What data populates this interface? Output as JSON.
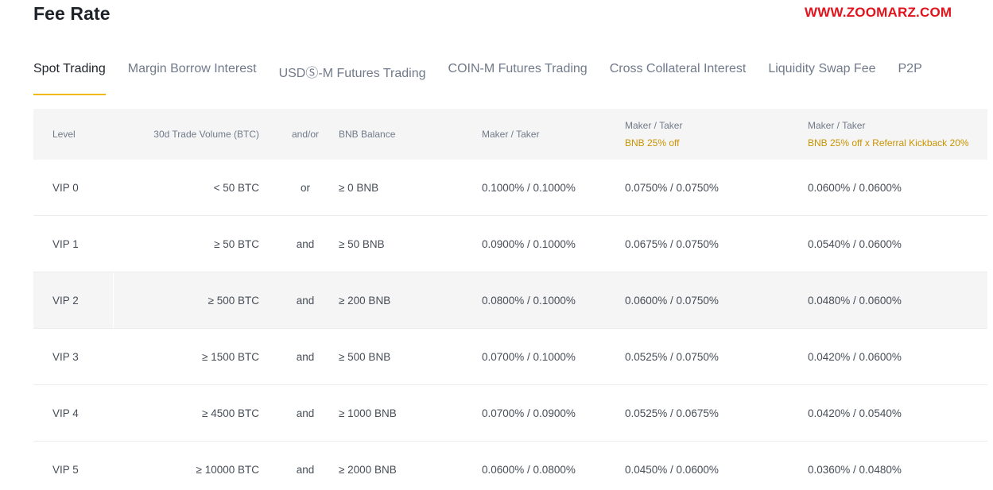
{
  "header": {
    "title": "Fee Rate",
    "watermark": "WWW.ZOOMARZ.COM"
  },
  "tabs": [
    {
      "label": "Spot Trading",
      "active": true
    },
    {
      "label": "Margin Borrow Interest",
      "active": false
    },
    {
      "label": "USDⓈ-M Futures Trading",
      "active": false
    },
    {
      "label": "COIN-M Futures Trading",
      "active": false
    },
    {
      "label": "Cross Collateral Interest",
      "active": false
    },
    {
      "label": "Liquidity Swap Fee",
      "active": false
    },
    {
      "label": "P2P",
      "active": false
    }
  ],
  "table": {
    "headers": {
      "level": "Level",
      "volume": "30d Trade Volume (BTC)",
      "andor": "and/or",
      "bnb_balance": "BNB Balance",
      "maker_taker": "Maker / Taker",
      "maker_taker_bnb": "Maker / Taker",
      "maker_taker_bnb_sub": "BNB 25% off",
      "maker_taker_ref": "Maker / Taker",
      "maker_taker_ref_sub": "BNB 25% off x Referral Kickback 20%"
    },
    "rows": [
      {
        "level": "VIP 0",
        "volume": "< 50 BTC",
        "andor": "or",
        "bnb": "≥ 0 BNB",
        "mt": "0.1000% / 0.1000%",
        "mt25": "0.0750% / 0.0750%",
        "mtref": "0.0600% / 0.0600%"
      },
      {
        "level": "VIP 1",
        "volume": "≥ 50 BTC",
        "andor": "and",
        "bnb": "≥ 50 BNB",
        "mt": "0.0900% / 0.1000%",
        "mt25": "0.0675% / 0.0750%",
        "mtref": "0.0540% / 0.0600%"
      },
      {
        "level": "VIP 2",
        "volume": "≥ 500 BTC",
        "andor": "and",
        "bnb": "≥ 200 BNB",
        "mt": "0.0800% / 0.1000%",
        "mt25": "0.0600% / 0.0750%",
        "mtref": "0.0480% / 0.0600%"
      },
      {
        "level": "VIP 3",
        "volume": "≥ 1500 BTC",
        "andor": "and",
        "bnb": "≥ 500 BNB",
        "mt": "0.0700% / 0.1000%",
        "mt25": "0.0525% / 0.0750%",
        "mtref": "0.0420% / 0.0600%"
      },
      {
        "level": "VIP 4",
        "volume": "≥ 4500 BTC",
        "andor": "and",
        "bnb": "≥ 1000 BNB",
        "mt": "0.0700% / 0.0900%",
        "mt25": "0.0525% / 0.0675%",
        "mtref": "0.0420% / 0.0540%"
      },
      {
        "level": "VIP 5",
        "volume": "≥ 10000 BTC",
        "andor": "and",
        "bnb": "≥ 2000 BNB",
        "mt": "0.0600% / 0.0800%",
        "mt25": "0.0450% / 0.0600%",
        "mtref": "0.0360% / 0.0480%"
      }
    ]
  },
  "colors": {
    "accent": "#f0b90b",
    "discount_text": "#c99400",
    "watermark": "#e1131c",
    "header_bg": "#f5f5f5"
  }
}
